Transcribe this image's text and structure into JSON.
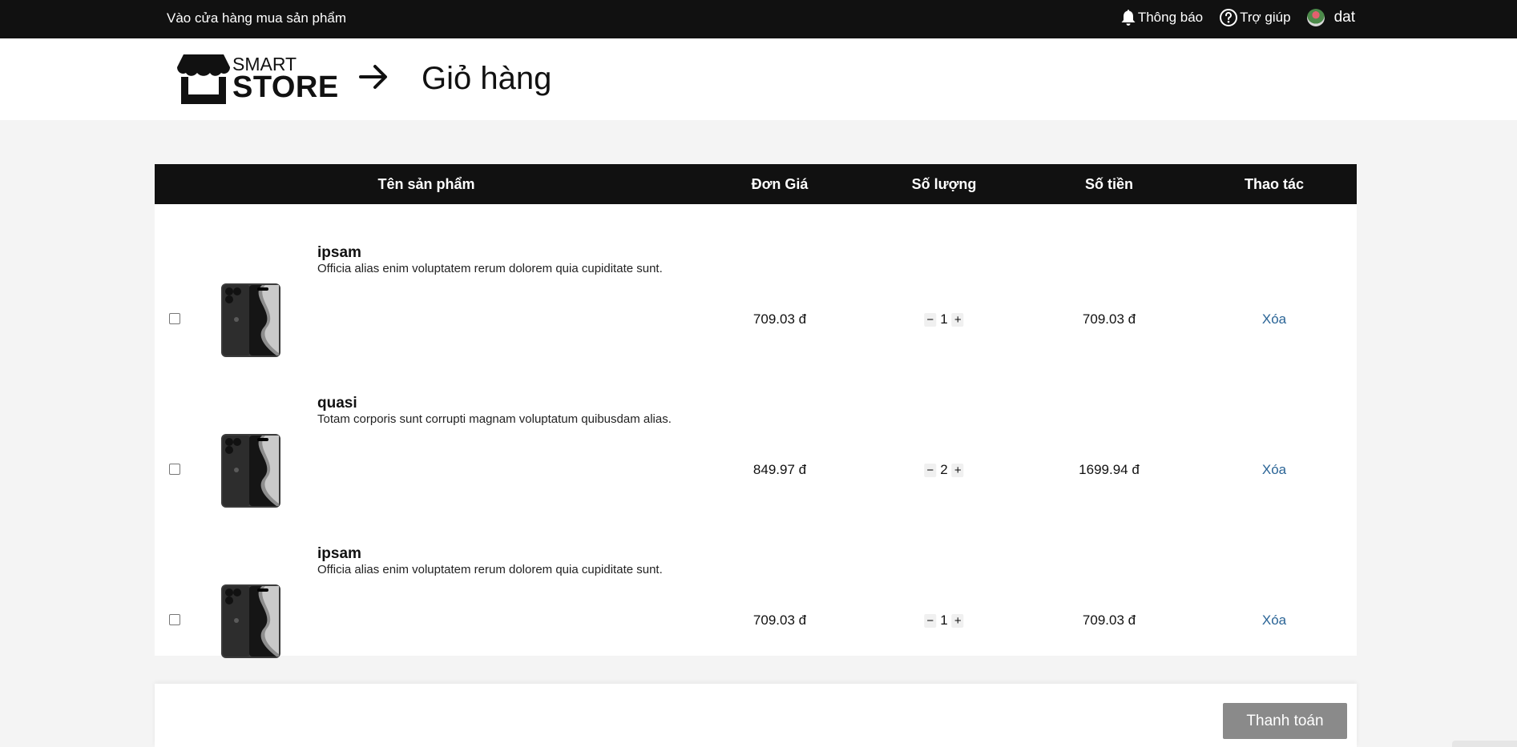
{
  "topbar": {
    "store_link": "Vào cửa hàng mua sản phẩm",
    "notifications": "Thông báo",
    "help": "Trợ giúp",
    "username": "dat"
  },
  "header": {
    "logo_top": "SMART",
    "logo_bottom": "STORE",
    "page_title": "Giỏ hàng"
  },
  "table": {
    "columns": {
      "product": "Tên sản phẩm",
      "unit_price": "Đơn Giá",
      "quantity": "Số lượng",
      "total": "Số tiền",
      "actions": "Thao tác"
    },
    "rows": [
      {
        "name": "ipsam",
        "description": "Officia alias enim voluptatem rerum dolorem quia cupiditate sunt.",
        "unit_price": "709.03 đ",
        "quantity": "1",
        "total": "709.03 đ",
        "delete": "Xóa"
      },
      {
        "name": "quasi",
        "description": "Totam corporis sunt corrupti magnam voluptatum quibusdam alias.",
        "unit_price": "849.97 đ",
        "quantity": "2",
        "total": "1699.94 đ",
        "delete": "Xóa"
      },
      {
        "name": "ipsam",
        "description": "Officia alias enim voluptatem rerum dolorem quia cupiditate sunt.",
        "unit_price": "709.03 đ",
        "quantity": "1",
        "total": "709.03 đ",
        "delete": "Xóa"
      }
    ]
  },
  "footer": {
    "checkout": "Thanh toán"
  },
  "icons": {
    "bell": "bell-icon",
    "help": "question-circle-icon",
    "arrow": "arrow-right-icon",
    "product": "phone-image"
  },
  "colors": {
    "topbar": "#111111",
    "link": "#2a6496",
    "checkout_button": "#8a8a8a"
  }
}
